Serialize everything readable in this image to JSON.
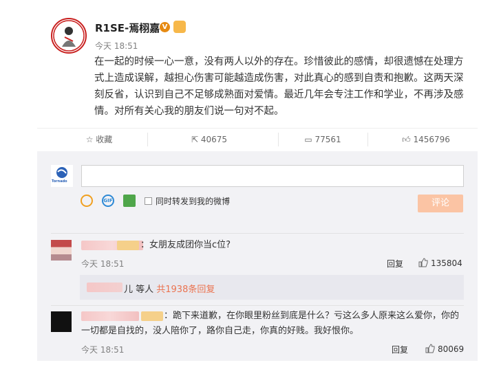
{
  "post": {
    "username": "R1SE-焉栩嘉",
    "time": "今天 18:51",
    "content": "在一起的时候一心一意，没有两人以外的存在。珍惜彼此的感情，却很遗憾在处理方式上造成误解，越担心伤害可能越造成伤害，对此真心的感到自责和抱歉。这两天深刻反省，认识到自己不足够成熟面对爱情。最近几年会专注工作和学业，不再涉及感情。对所有关心我的朋友们说一句对不起。"
  },
  "actions": {
    "favorite": "收藏",
    "forward": "40675",
    "comment": "77561",
    "like": "1456796"
  },
  "composer": {
    "forward_label": "同时转发到我的微博",
    "submit_label": "评论",
    "avatar_text": "Tornado"
  },
  "comments": [
    {
      "text": "女朋友成团你当c位?",
      "time": "今天 18:51",
      "reply_label": "回复",
      "likes": "135804",
      "sub_replies": {
        "suffix": "儿 等人 ",
        "link": "共1938条回复"
      }
    },
    {
      "text": "跪下来道歉，在你眼里粉丝到底是什么？亏这么多人原来这么爱你，你的一切都是自找的，没人陪你了，路你自己走，你真的好贱。我好恨你。",
      "time": "今天 18:51",
      "reply_label": "回复",
      "likes": "80069"
    }
  ],
  "colors": {
    "accent": "#eb7350",
    "panel": "#f2f2f5",
    "verified": "#e68a12"
  }
}
